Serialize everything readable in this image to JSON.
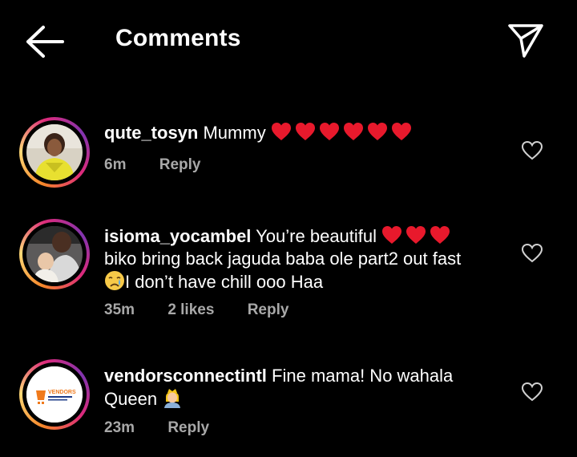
{
  "header": {
    "title": "Comments",
    "back_icon": "arrow-left-icon",
    "share_icon": "paper-plane-icon"
  },
  "comments": [
    {
      "username": "qute_tosyn",
      "text": "Mummy",
      "hearts": 6,
      "time": "6m",
      "reply": "Reply"
    },
    {
      "username": "isioma_yocambel",
      "text_line1": "You’re beautiful",
      "hearts": 3,
      "text_line2": "biko bring back jaguda baba ole part2 out fast",
      "text_line3": "I don’t have chill ooo Haa",
      "emoji": "crying-face-icon",
      "time": "35m",
      "likes": "2 likes",
      "reply": "Reply"
    },
    {
      "username": "vendorsconnectintl",
      "text_line1": "Fine mama! No wahala",
      "text_line2": "Queen",
      "emoji": "princess-icon",
      "avatar_logo": "VENDORS",
      "time": "23m",
      "reply": "Reply"
    }
  ],
  "colors": {
    "background": "#000000",
    "text": "#ffffff",
    "meta": "#a8a8a8",
    "heart": "#e8192c"
  }
}
